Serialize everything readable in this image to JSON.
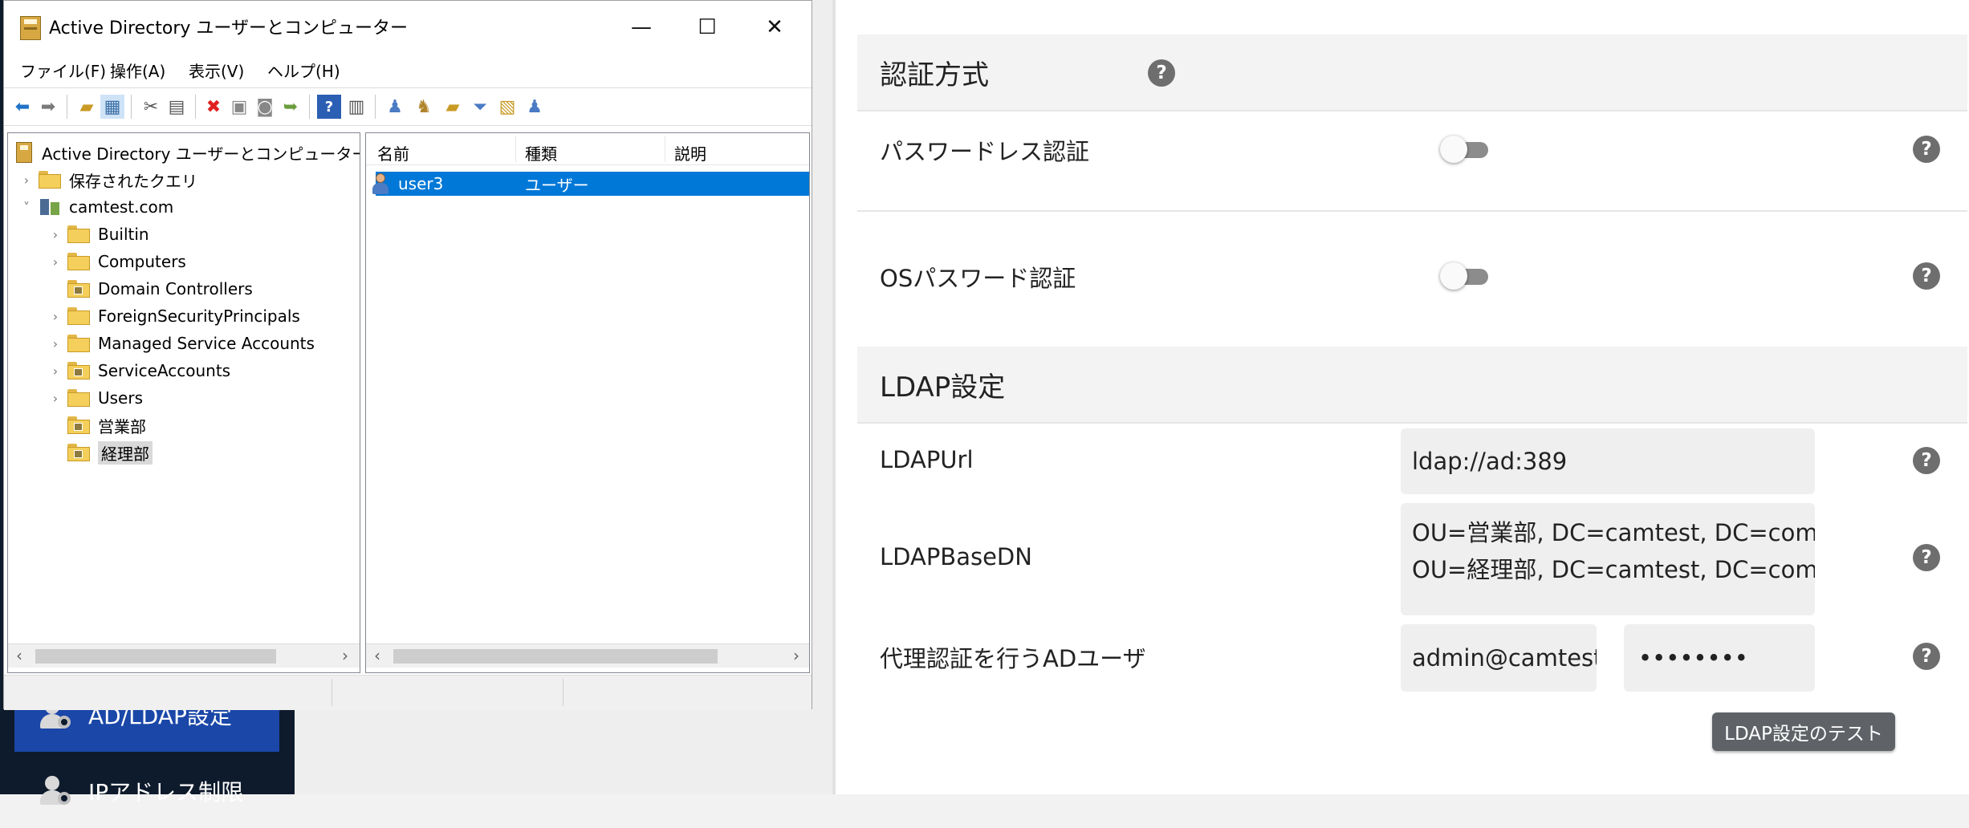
{
  "sidebar": {
    "items": [
      {
        "label": "AD/LDAP設定",
        "icon": "user-gear-icon",
        "active": true
      },
      {
        "label": "IPアドレス制限",
        "icon": "user-gear-icon",
        "active": false
      }
    ]
  },
  "settings": {
    "auth_section": {
      "title": "認証方式",
      "passwordless": {
        "label": "パスワードレス認証",
        "enabled": false
      },
      "os_password": {
        "label": "OSパスワード認証",
        "enabled": false
      }
    },
    "ldap_section": {
      "title": "LDAP設定",
      "url": {
        "label": "LDAPUrl",
        "value": "ldap://ad:389"
      },
      "base_dn": {
        "label": "LDAPBaseDN",
        "lines": [
          "OU=営業部, DC=camtest, DC=com",
          "OU=経理部, DC=camtest, DC=com"
        ]
      },
      "proxy_user": {
        "label": "代理認証を行うADユーザ",
        "user_value": "admin@camtest",
        "password_value": "••••••••"
      },
      "test_button": "LDAP設定のテスト"
    },
    "help_glyph": "?"
  },
  "ad_window": {
    "title": "Active Directory ユーザーとコンピューター",
    "controls": {
      "minimize": "—",
      "maximize": "☐",
      "close": "✕"
    },
    "menu": [
      "ファイル(F)",
      "操作(A)",
      "表示(V)",
      "ヘルプ(H)"
    ],
    "tree": {
      "root": "Active Directory ユーザーとコンピューター [ad.ca",
      "saved_queries": "保存されたクエリ",
      "domain": "camtest.com",
      "children": [
        {
          "label": "Builtin",
          "type": "folder",
          "expandable": true
        },
        {
          "label": "Computers",
          "type": "folder",
          "expandable": true
        },
        {
          "label": "Domain Controllers",
          "type": "ou",
          "expandable": false
        },
        {
          "label": "ForeignSecurityPrincipals",
          "type": "folder",
          "expandable": true
        },
        {
          "label": "Managed Service Accounts",
          "type": "folder",
          "expandable": true
        },
        {
          "label": "ServiceAccounts",
          "type": "ou",
          "expandable": true
        },
        {
          "label": "Users",
          "type": "folder",
          "expandable": true
        },
        {
          "label": "営業部",
          "type": "ou",
          "expandable": false
        },
        {
          "label": "経理部",
          "type": "ou",
          "expandable": false,
          "selected": true
        }
      ]
    },
    "list": {
      "columns": [
        "名前",
        "種類",
        "説明"
      ],
      "rows": [
        {
          "name": "user3",
          "type": "ユーザー",
          "description": ""
        }
      ]
    }
  }
}
